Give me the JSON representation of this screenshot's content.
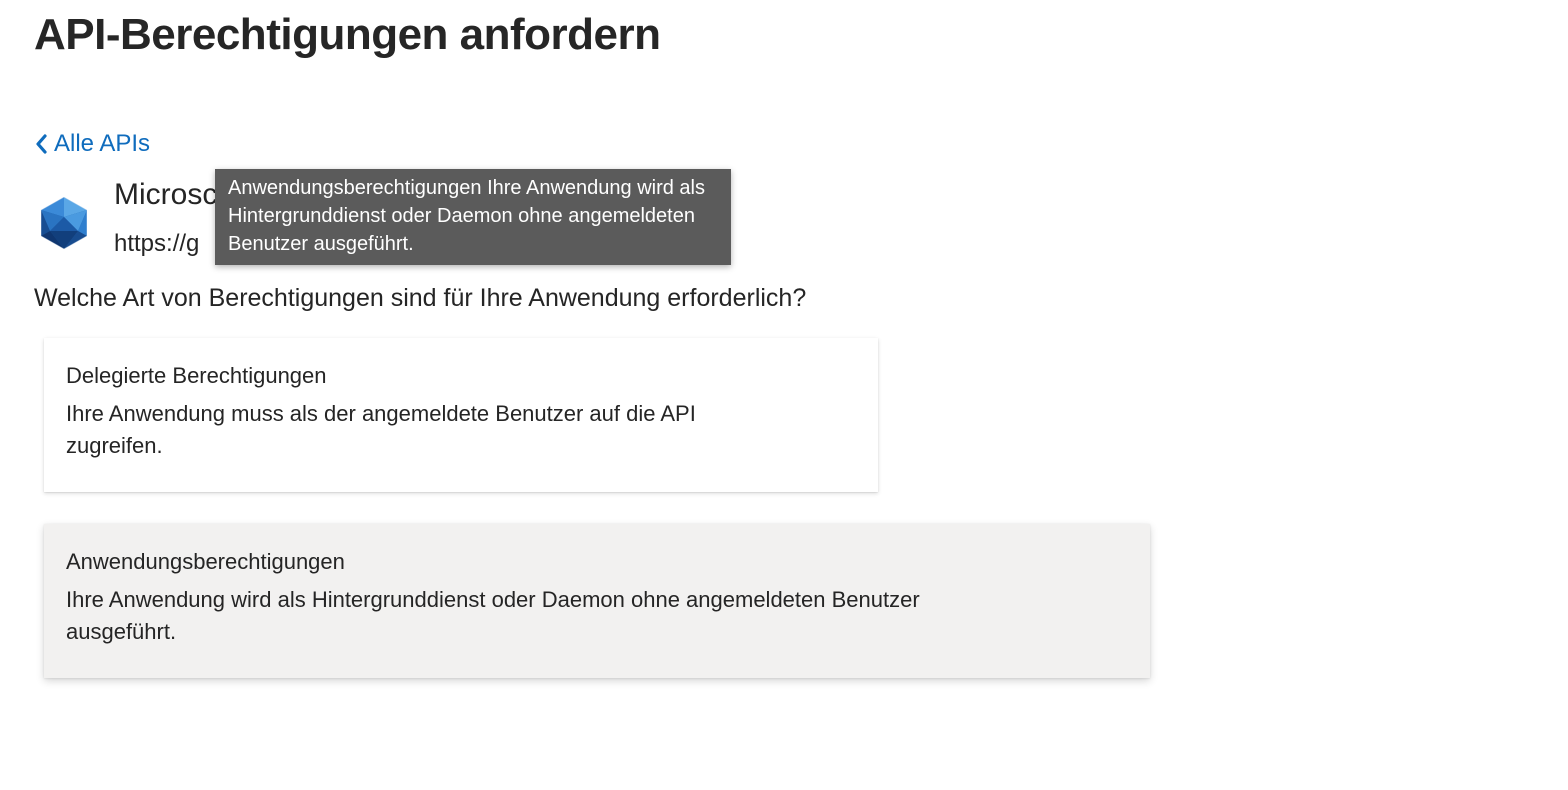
{
  "page": {
    "title": "API-Berechtigungen anfordern"
  },
  "nav": {
    "back_label": "Alle APIs",
    "back_icon": "chevron-left-icon"
  },
  "api": {
    "name": "Microsc",
    "url": "https://g",
    "logo_icon": "microsoft-graph-icon"
  },
  "tooltip": {
    "text": "Anwendungsberechtigungen Ihre Anwendung wird als Hintergrunddienst oder Daemon ohne angemeldeten Benutzer ausgeführt."
  },
  "question": "Welche Art von Berechtigungen sind für Ihre Anwendung erforderlich?",
  "permission_types": [
    {
      "title": "Delegierte Berechtigungen",
      "description": "Ihre Anwendung muss als der angemeldete Benutzer auf die API zugreifen."
    },
    {
      "title": "Anwendungsberechtigungen",
      "description": "Ihre Anwendung wird als Hintergrunddienst oder Daemon ohne angemeldeten Benutzer ausgeführt."
    }
  ],
  "colors": {
    "link": "#0f6cbd",
    "tooltip_bg": "#5b5b5b",
    "hover_card_bg": "#f2f1f0"
  }
}
